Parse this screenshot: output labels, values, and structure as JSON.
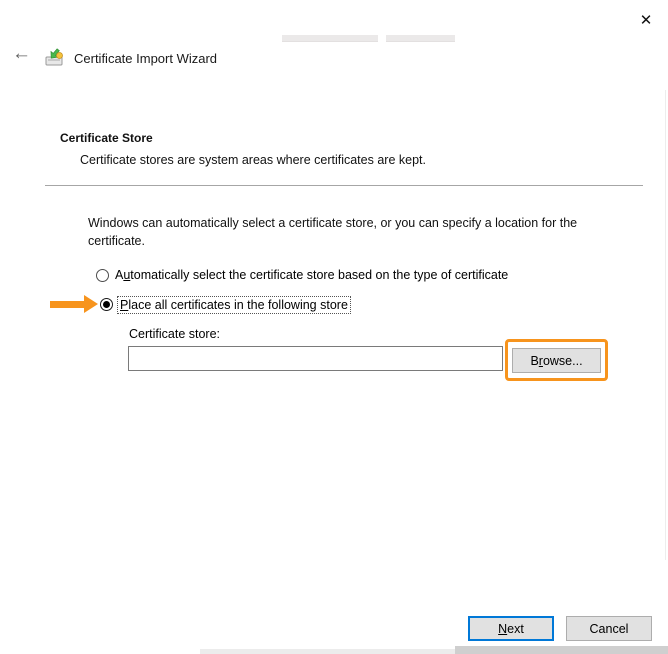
{
  "window": {
    "close_icon": "✕"
  },
  "header": {
    "back_icon": "←",
    "title": "Certificate Import Wizard"
  },
  "section": {
    "heading": "Certificate Store",
    "description": "Certificate stores are system areas where certificates are kept."
  },
  "body": {
    "intro": "Windows can automatically select a certificate store, or you can specify a location for the certificate."
  },
  "radios": [
    {
      "label_pre": "A",
      "label_key": "u",
      "label_post": "tomatically select the certificate store based on the type of certificate",
      "selected": false
    },
    {
      "label_pre": "",
      "label_key": "P",
      "label_post": "lace all certificates in the following store",
      "selected": true
    }
  ],
  "store_field": {
    "label": "Certificate store:",
    "value": "",
    "browse_pre": "B",
    "browse_key": "r",
    "browse_post": "owse..."
  },
  "footer": {
    "next_pre": "",
    "next_key": "N",
    "next_post": "ext",
    "cancel_label": "Cancel"
  },
  "annotations": {
    "arrow_color": "#f7941d",
    "highlight_box_color": "#f7941d"
  },
  "colors": {
    "accent_blue": "#0078d7",
    "button_face": "#e1e1e1",
    "divider_gray": "#a6a6a6"
  }
}
